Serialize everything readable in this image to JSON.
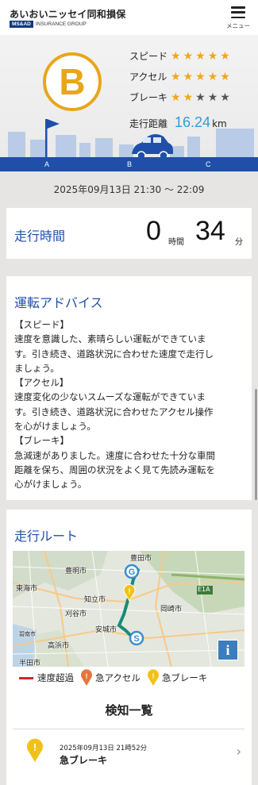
{
  "header": {
    "brand_name": "あいおいニッセイ同和損保",
    "brand_badge": "MS&AD",
    "brand_group": "INSURANCE GROUP",
    "menu_label": "メニュー"
  },
  "score": {
    "grade": "B",
    "metrics": [
      {
        "label": "スピード",
        "stars": 5,
        "max": 5
      },
      {
        "label": "アクセル",
        "stars": 5,
        "max": 5
      },
      {
        "label": "ブレーキ",
        "stars": 2,
        "max": 5
      }
    ],
    "distance_label": "走行距離",
    "distance_value": "16.24",
    "distance_unit": "km",
    "points": [
      "A",
      "B",
      "C"
    ]
  },
  "trip": {
    "datetime": "2025年09月13日 21:30 〜 22:09"
  },
  "drive_time": {
    "title": "走行時間",
    "hours": "0",
    "hours_unit": "時間",
    "minutes": "34",
    "minutes_unit": "分"
  },
  "advice": {
    "title": "運転アドバイス",
    "lines": [
      "【スピード】",
      "速度を意識した、素晴らしい運転ができていま",
      "す。引き続き、道路状況に合わせた速度で走行し",
      "ましょう。",
      "【アクセル】",
      "速度変化の少ないスムーズな運転ができていま",
      "す。引き続き、道路状況に合わせたアクセル操作",
      "を心がけましょう。",
      "【ブレーキ】",
      "急減速がありました。速度に合わせた十分な車間",
      "距離を保ち、周囲の状況をよく見て先読み運転を",
      "心がけましょう。"
    ]
  },
  "route": {
    "title": "走行ルート",
    "map_labels": [
      "豊田市",
      "豊明市",
      "東海市",
      "知立市",
      "刈谷市",
      "安城市",
      "高浜市",
      "碧南市",
      "半田市",
      "岡崎市",
      "E1A"
    ],
    "map_info": "i",
    "legend": [
      {
        "label": "速度超過",
        "icon": "red-line-icon",
        "color": "#d8232a"
      },
      {
        "label": "急アクセル",
        "icon": "orange-pin-icon",
        "color": "#e8743b"
      },
      {
        "label": "急ブレーキ",
        "icon": "yellow-pin-icon",
        "color": "#f2c118"
      }
    ],
    "detect_title": "検知一覧",
    "detections": [
      {
        "time": "2025年09月13日 21時52分",
        "label": "急ブレーキ"
      }
    ]
  },
  "colors": {
    "brand_blue": "#1f4fa8",
    "accent_sky": "#2d9fd9",
    "grade_gold": "#e8a61b",
    "star_on": "#f3a61b",
    "route_teal": "#1a8a78"
  }
}
